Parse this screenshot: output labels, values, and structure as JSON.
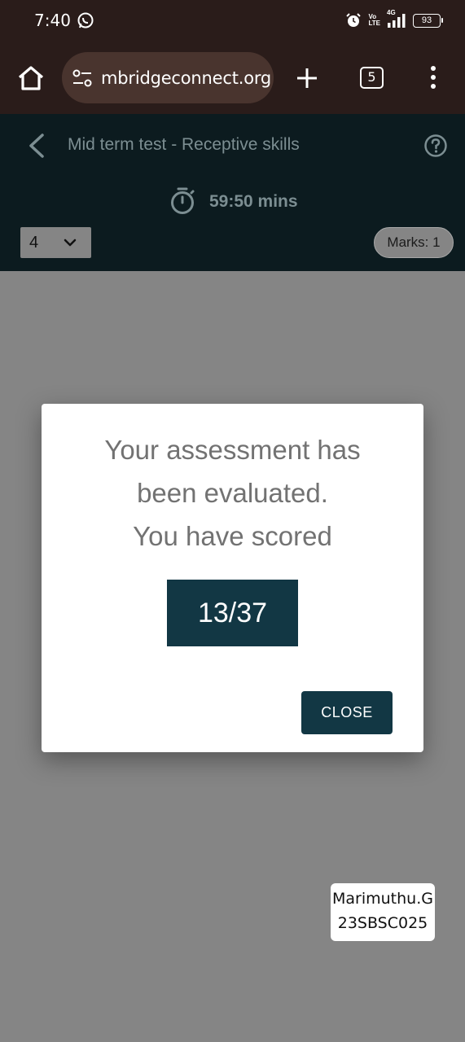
{
  "status_bar": {
    "time": "7:40",
    "battery": "93",
    "network_label": "4G",
    "lte_label_top": "Vo",
    "lte_label_bottom": "LTE"
  },
  "browser": {
    "url": "mbridgeconnect.org",
    "tab_count": "5"
  },
  "header": {
    "title": "Mid term test - Receptive skills",
    "timer": "59:50 mins",
    "question_number": "4",
    "marks": "Marks: 1"
  },
  "modal": {
    "message_line1": "Your assessment has",
    "message_line2": "been evaluated.",
    "message_line3": "You have scored",
    "score": "13/37",
    "close_label": "CLOSE"
  },
  "name_tag": {
    "name": "Marimuthu.G",
    "id": "23SBSC025"
  },
  "colors": {
    "browser_bar": "#2a1c1a",
    "header_bg": "#0c1b1f",
    "overlay": "#858585",
    "accent": "#123744"
  },
  "icons": [
    "whatsapp-icon",
    "alarm-icon",
    "signal-icon",
    "home-icon",
    "site-settings-icon",
    "plus-icon",
    "kebab-menu-icon",
    "back-arrow-icon",
    "help-icon",
    "stopwatch-icon",
    "chevron-down-icon"
  ]
}
